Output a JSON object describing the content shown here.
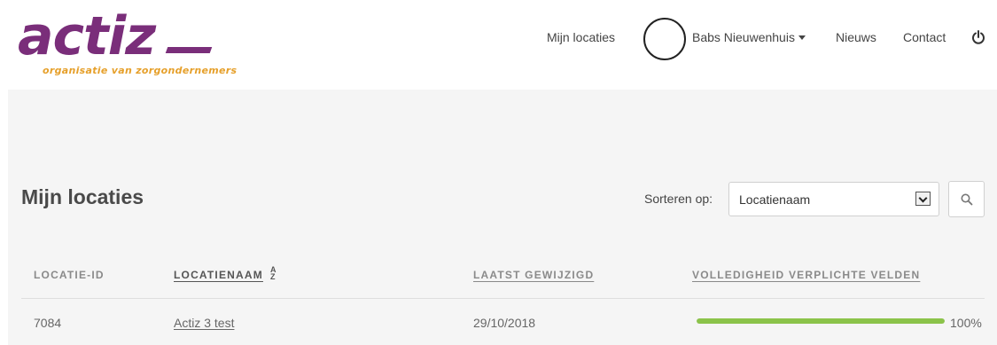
{
  "brand": {
    "logo_word": "actiz",
    "tagline": "organisatie van zorgondernemers",
    "primary_color": "#7a2e7a",
    "accent_color": "#e6a02b"
  },
  "nav": {
    "my_locations": "Mijn locaties",
    "user_name": "Babs Nieuwenhuis",
    "news": "Nieuws",
    "contact": "Contact",
    "power_icon": "power-icon"
  },
  "page": {
    "title": "Mijn locaties"
  },
  "sort": {
    "label": "Sorteren op:",
    "selected": "Locatienaam"
  },
  "table": {
    "columns": [
      "LOCATIE-ID",
      "LOCATIENAAM",
      "LAATST GEWIJZIGD",
      "VOLLEDIGHEID VERPLICHTE VELDEN"
    ],
    "rows": [
      {
        "id": "7084",
        "name": "Actiz 3 test",
        "modified": "29/10/2018",
        "completeness": 1.0,
        "completeness_label": "100%"
      }
    ],
    "progress_color": "#8bc34a"
  }
}
